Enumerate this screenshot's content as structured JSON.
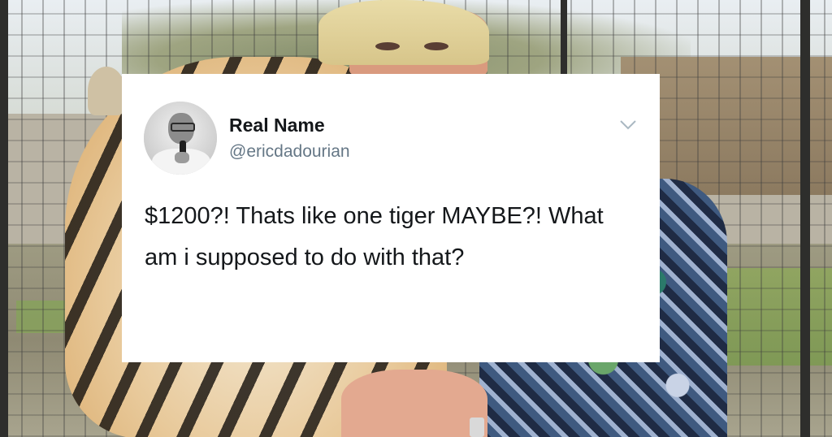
{
  "tweet": {
    "display_name": "Real Name",
    "handle": "@ericdadourian",
    "text": "$1200?! Thats like one tiger MAYBE?! What am i supposed to do with that?"
  },
  "icons": {
    "menu": "chevron-down-icon",
    "avatar": "profile-photo"
  },
  "colors": {
    "card_bg": "#ffffff",
    "name_color": "#14171a",
    "handle_color": "#657786"
  }
}
